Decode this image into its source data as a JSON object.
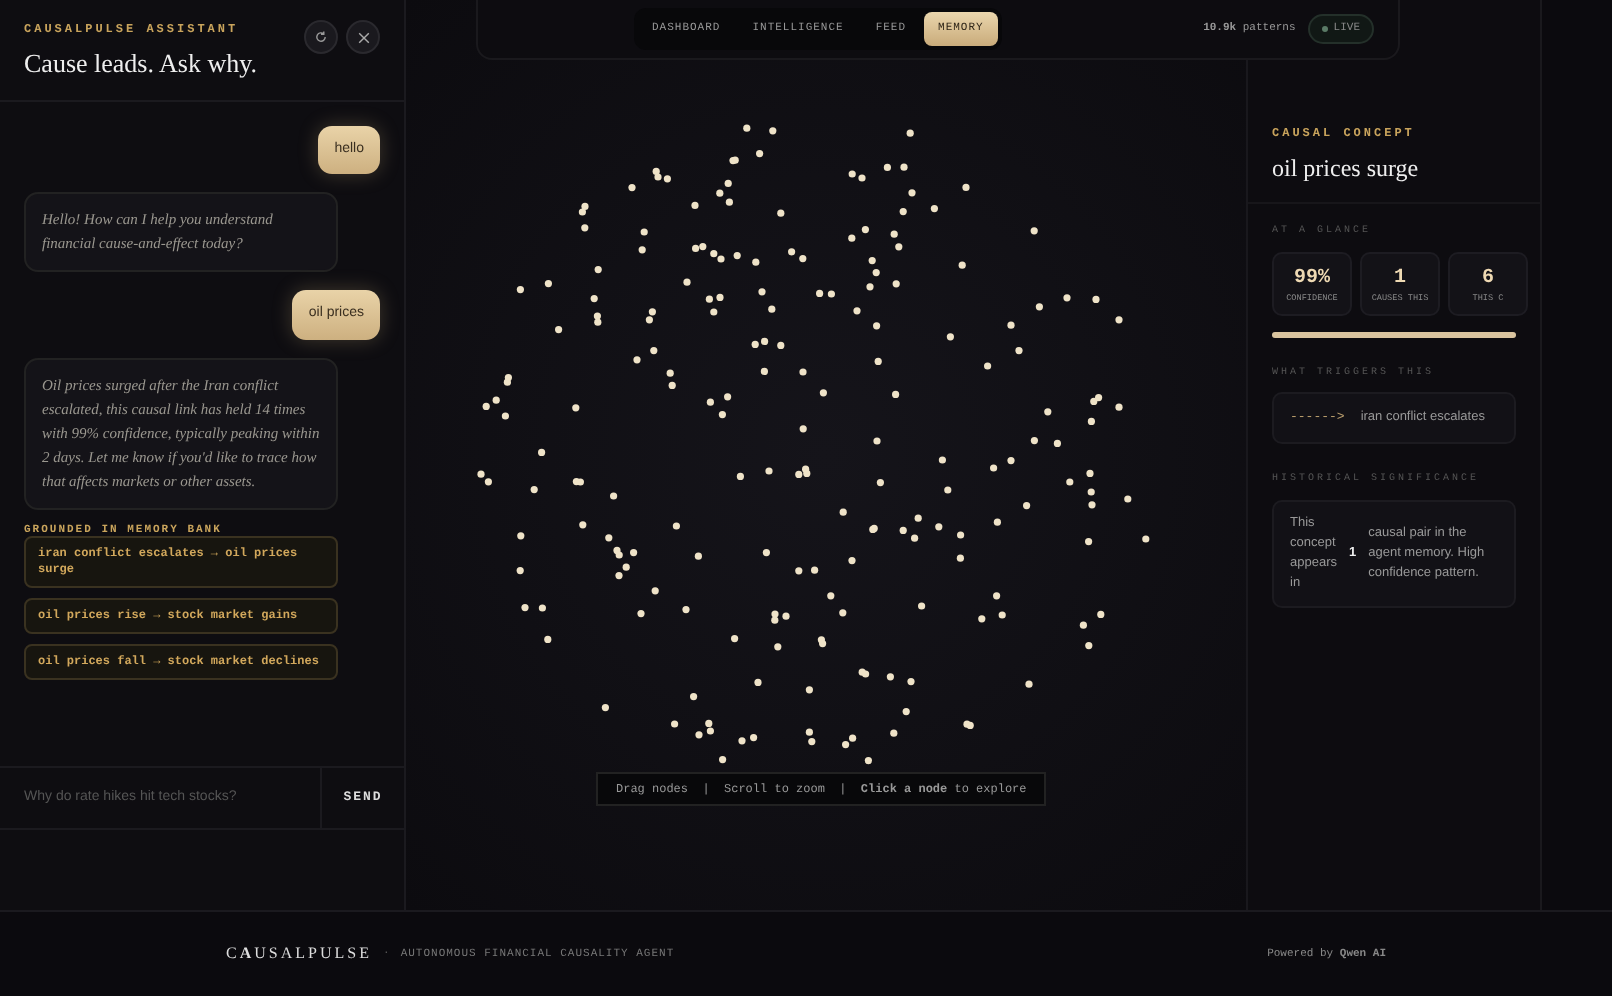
{
  "assistant": {
    "eyebrow": "CAUSALPULSE ASSISTANT",
    "title": "Cause leads. Ask why.",
    "messages": [
      {
        "kind": "user",
        "text": "hello"
      },
      {
        "kind": "reply",
        "text": "Hello! How can I help you understand financial cause-and-effect today?"
      },
      {
        "kind": "user",
        "text": "oil prices"
      },
      {
        "kind": "reply",
        "text": "Oil prices surged after the Iran conflict escalated, this causal link has held 14 times with 99% confidence, typically peaking within 2 days. Let me know if you'd like to trace how that affects markets or other assets."
      }
    ],
    "memory": {
      "heading": "GROUNDED IN MEMORY BANK",
      "items": [
        "iran conflict escalates → oil prices surge",
        "oil prices rise → stock market gains",
        "oil prices fall → stock market declines"
      ]
    },
    "input": {
      "placeholder": "Why do rate hikes hit tech stocks?",
      "send": "SEND"
    }
  },
  "nav": {
    "tabs": [
      {
        "label": "DASHBOARD",
        "selected": false
      },
      {
        "label": "INTELLIGENCE",
        "selected": false
      },
      {
        "label": "FEED",
        "selected": false
      },
      {
        "label": "MEMORY",
        "selected": true
      }
    ],
    "patterns": "**10.9k** patterns",
    "live": "LIVE"
  },
  "graph": {
    "hint": "Drag nodes  |  Scroll to zoom  |  **Click a node** to explore"
  },
  "concept": {
    "eyebrow": "CAUSAL CONCEPT",
    "title": "oil prices surge",
    "glance_heading": "AT A GLANCE",
    "stats": [
      {
        "value": "99%",
        "label": "CONFIDENCE"
      },
      {
        "value": "1",
        "label": "CAUSES THIS"
      },
      {
        "value": "6",
        "label": "THIS C"
      }
    ],
    "level": 1,
    "triggers_heading": "WHAT TRIGGERS THIS",
    "triggers": [
      {
        "arrow": "------>",
        "text": "iran conflict escalates"
      }
    ],
    "history_heading": "HISTORICAL SIGNIFICANCE",
    "history": {
      "before": "This concept appears in",
      "count": "1",
      "after": "causal pair in the agent memory. High confidence pattern."
    }
  },
  "footer": {
    "logo": "C**A**USALPULSE",
    "separator": "·",
    "tagline": "AUTONOMOUS FINANCIAL CAUSALITY AGENT",
    "powered": "Powered by **Qwen AI**"
  }
}
